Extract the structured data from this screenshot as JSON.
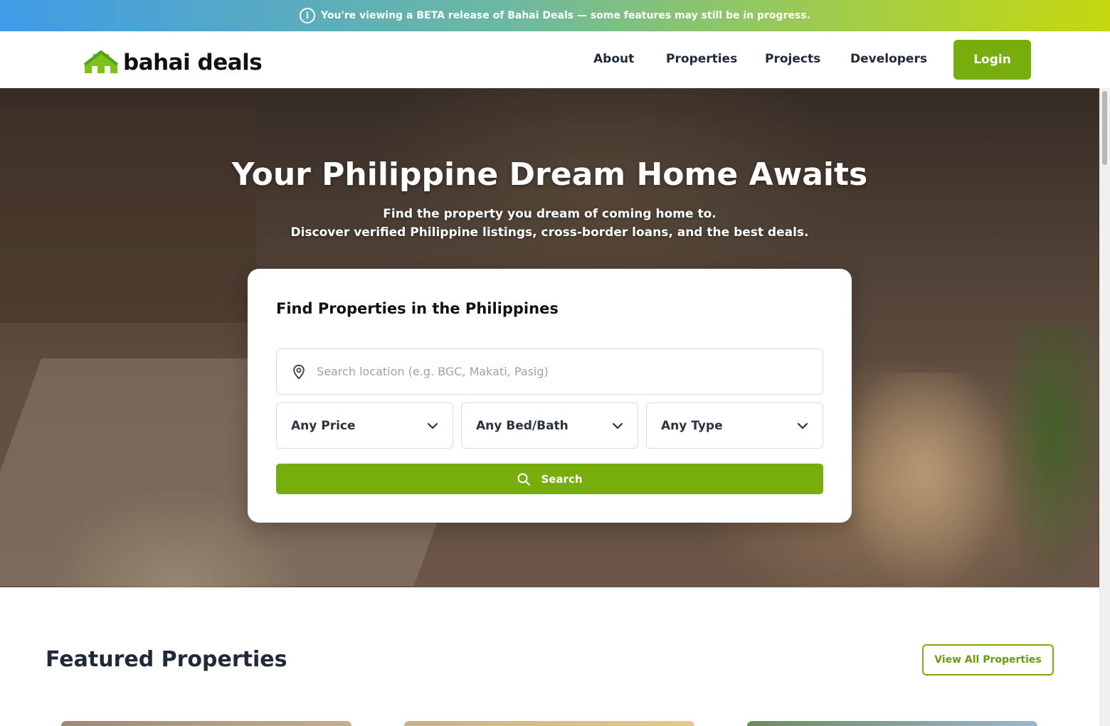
{
  "banner": {
    "text": "You're viewing a BETA release of Bahai Deals — some features may still be in progress."
  },
  "header": {
    "logo_text": "bahai deals",
    "nav": [
      {
        "label": "About"
      },
      {
        "label": "Properties"
      },
      {
        "label": "Projects"
      },
      {
        "label": "Developers"
      }
    ],
    "login_label": "Login"
  },
  "hero": {
    "title": "Your Philippine Dream Home Awaits",
    "subtitle_line1": "Find the property you dream of coming home to.",
    "subtitle_line2": "Discover verified Philippine listings, cross-border loans, and the best deals."
  },
  "search_card": {
    "title": "Find Properties in the Philippines",
    "location_placeholder": "Search location (e.g. BGC, Makati, Pasig)",
    "price_label": "Any Price",
    "bedbath_label": "Any Bed/Bath",
    "type_label": "Any Type",
    "search_label": "Search"
  },
  "featured": {
    "title": "Featured Properties",
    "view_all_label": "View All Properties"
  },
  "colors": {
    "brand_green": "#78ad0e",
    "banner_gradient_start": "#3f9be6",
    "banner_gradient_end": "#c5d80f"
  },
  "icons": {
    "banner": "info-icon",
    "location": "map-pin-icon",
    "select": "chevron-down-icon",
    "search": "search-icon"
  }
}
